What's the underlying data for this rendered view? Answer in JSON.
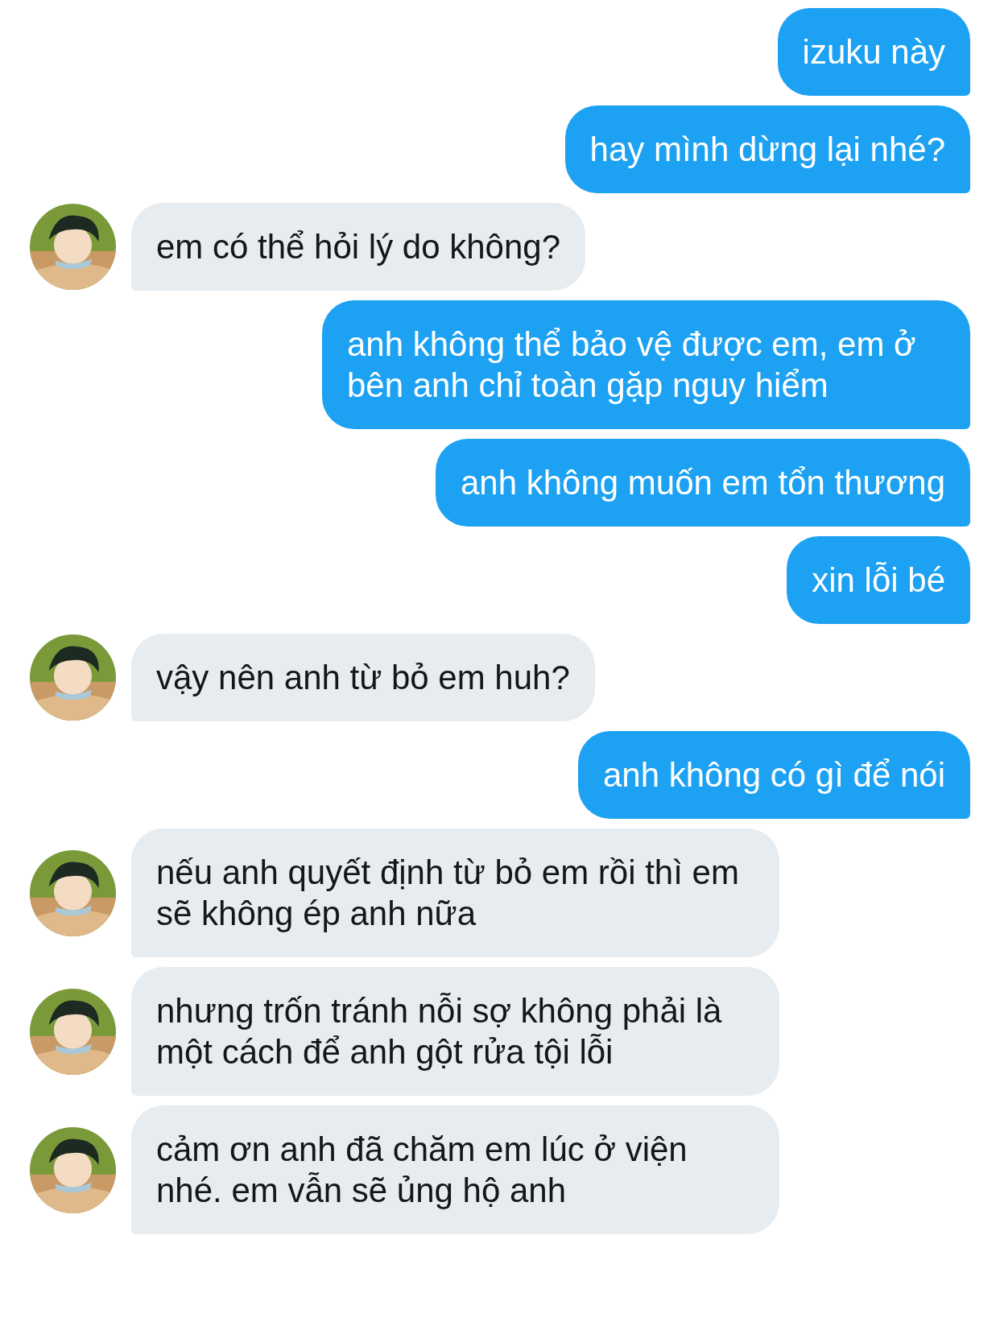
{
  "messages": [
    {
      "kind": "sent",
      "text": "izuku này"
    },
    {
      "kind": "sent",
      "text": "hay mình dừng lại nhé?"
    },
    {
      "kind": "received",
      "text": "em có thể hỏi lý do không?"
    },
    {
      "kind": "sent",
      "text": "anh không thể bảo vệ được em, em ở bên anh chỉ toàn gặp nguy hiểm"
    },
    {
      "kind": "sent",
      "text": "anh không muốn em tổn thương"
    },
    {
      "kind": "sent",
      "text": "xin lỗi bé"
    },
    {
      "kind": "received",
      "text": "vậy nên anh từ bỏ em huh?"
    },
    {
      "kind": "sent",
      "text": "anh không có gì để nói"
    },
    {
      "kind": "received",
      "text": "nếu anh quyết định từ bỏ em rồi thì em sẽ không ép anh nữa"
    },
    {
      "kind": "received",
      "text": "nhưng trốn tránh nỗi sợ không phải là một cách để anh gột rửa tội lỗi"
    },
    {
      "kind": "received",
      "text": "cảm ơn anh đã chăm em lúc ở viện nhé. em vẫn sẽ ủng hộ anh"
    }
  ]
}
